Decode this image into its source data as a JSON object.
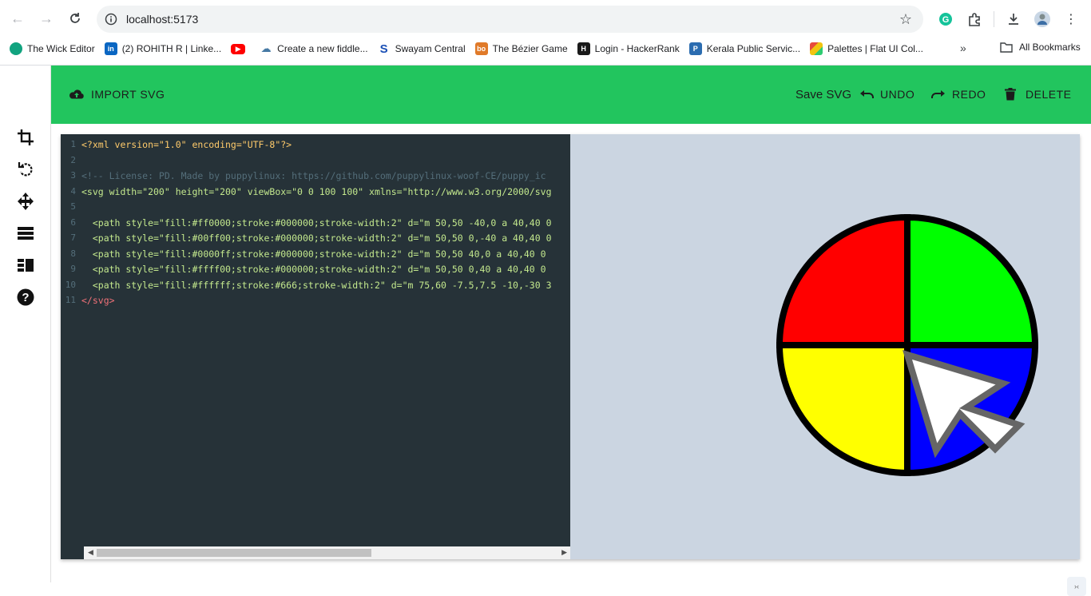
{
  "browser": {
    "url": "localhost:5173",
    "bookmarks": [
      {
        "label": "The Wick Editor",
        "icon": "wick-icon",
        "color": "#11a37f"
      },
      {
        "label": "(2) ROHITH R | Linke...",
        "icon": "linkedin-icon",
        "color": "#0a66c2"
      },
      {
        "label": "",
        "icon": "youtube-icon",
        "color": "#ff0000"
      },
      {
        "label": "Create a new fiddle...",
        "icon": "jsfiddle-icon",
        "color": "#4679a4"
      },
      {
        "label": "Swayam Central",
        "icon": "swayam-icon",
        "color": "#1a4fb5"
      },
      {
        "label": "The Bézier Game",
        "icon": "bezier-icon",
        "color": "#e07a29"
      },
      {
        "label": "Login - HackerRank",
        "icon": "hackerrank-icon",
        "color": "#1a1a1a"
      },
      {
        "label": "Kerala Public Servic...",
        "icon": "kpsc-icon",
        "color": "#2b6cb0"
      },
      {
        "label": "Palettes | Flat UI Col...",
        "icon": "flatui-icon",
        "color": "#e74c3c"
      }
    ],
    "more_label": "»",
    "all_bookmarks_label": "All Bookmarks"
  },
  "toolbar": {
    "import_label": "IMPORT SVG",
    "save_label": "Save SVG",
    "undo_label": "UNDO",
    "redo_label": "REDO",
    "delete_label": "DELETE",
    "accent": "#22c55e"
  },
  "sidebar": {
    "icons": [
      "crop-icon",
      "rotate-icon",
      "move-icon",
      "layers-icon",
      "list-icon",
      "help-icon"
    ]
  },
  "editor": {
    "lines": [
      {
        "n": "1",
        "text": "<?xml version=\"1.0\" encoding=\"UTF-8\"?>"
      },
      {
        "n": "2",
        "text": ""
      },
      {
        "n": "3",
        "text": "<!-- License: PD. Made by puppylinux: https://github.com/puppylinux-woof-CE/puppy_ic"
      },
      {
        "n": "4",
        "text": "<svg width=\"200\" height=\"200\" viewBox=\"0 0 100 100\" xmlns=\"http://www.w3.org/2000/svg"
      },
      {
        "n": "5",
        "text": ""
      },
      {
        "n": "6",
        "text": "  <path style=\"fill:#ff0000;stroke:#000000;stroke-width:2\" d=\"m 50,50 -40,0 a 40,40 0"
      },
      {
        "n": "7",
        "text": "  <path style=\"fill:#00ff00;stroke:#000000;stroke-width:2\" d=\"m 50,50 0,-40 a 40,40 0"
      },
      {
        "n": "8",
        "text": "  <path style=\"fill:#0000ff;stroke:#000000;stroke-width:2\" d=\"m 50,50 40,0 a 40,40 0"
      },
      {
        "n": "9",
        "text": "  <path style=\"fill:#ffff00;stroke:#000000;stroke-width:2\" d=\"m 50,50 0,40 a 40,40 0"
      },
      {
        "n": "10",
        "text": "  <path style=\"fill:#ffffff;stroke:#666;stroke-width:2\" d=\"m 75,60 -7.5,7.5 -10,-30 3"
      },
      {
        "n": "11",
        "text": "</svg>"
      }
    ]
  },
  "preview": {
    "background": "#cbd5e1",
    "colors": {
      "red": "#ff0000",
      "green": "#00ff00",
      "blue": "#0000ff",
      "yellow": "#ffff00"
    }
  }
}
